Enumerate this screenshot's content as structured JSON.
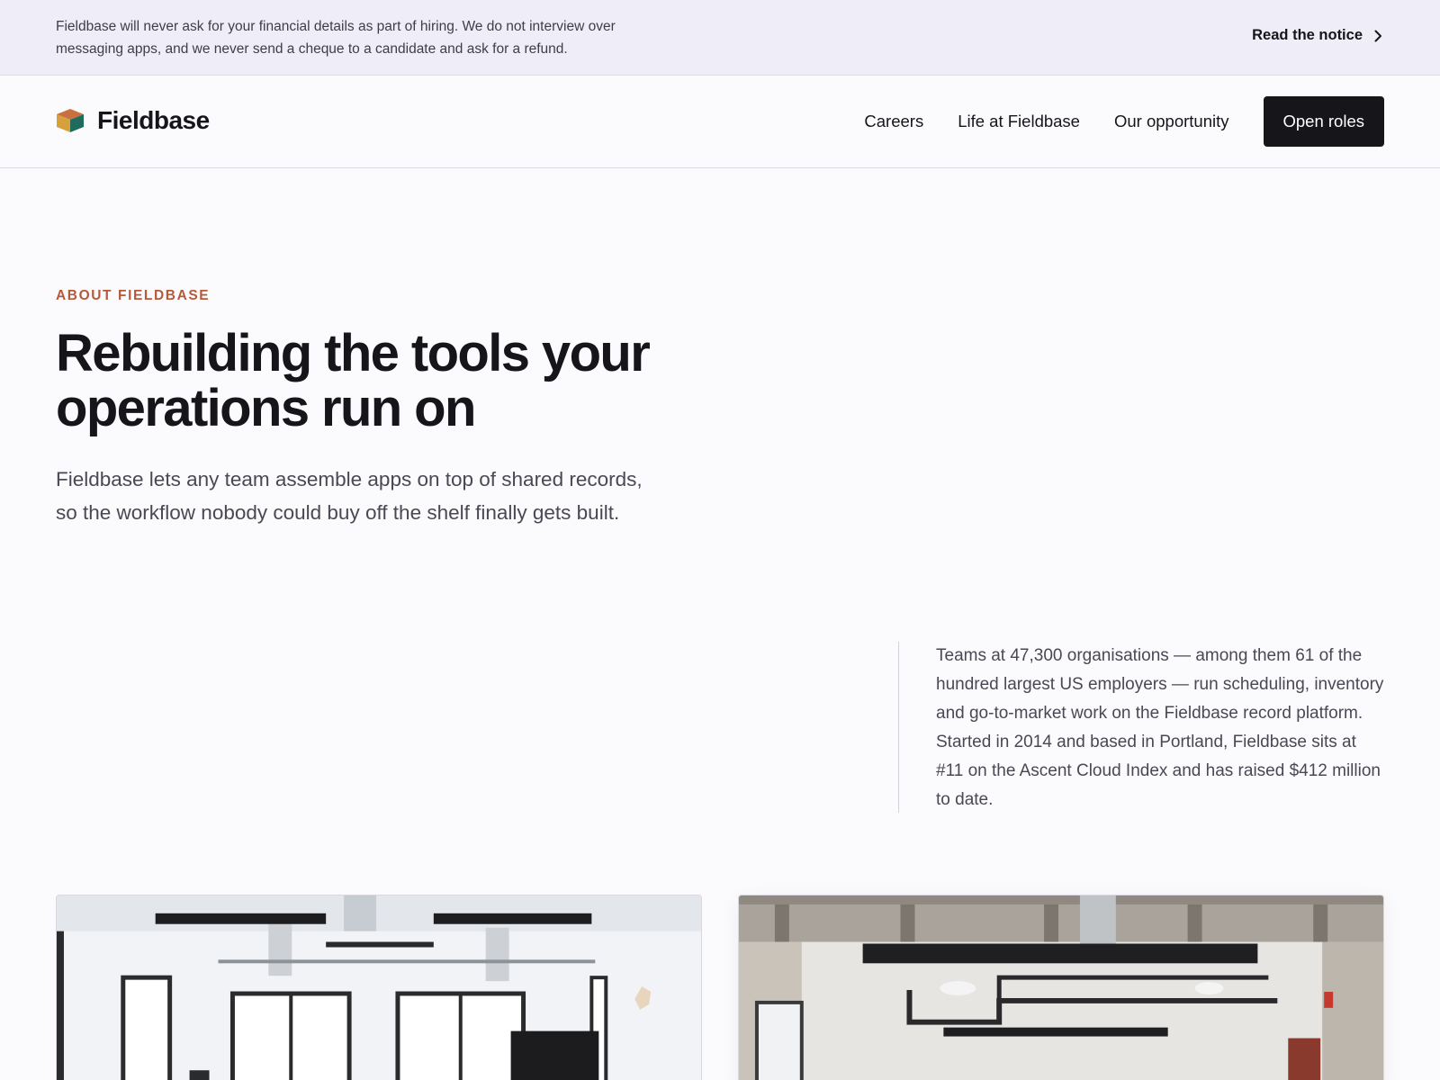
{
  "notice": {
    "text": "Fieldbase will never ask for your financial details as part of hiring. We do not interview over messaging apps, and we never send a cheque to a candidate and ask for a refund.",
    "link_label": "Read the notice",
    "link_icon": "chevron-right-icon"
  },
  "header": {
    "brand_name": "Fieldbase",
    "logo_icon": "cube-logo",
    "nav": [
      "Careers",
      "Life at Fieldbase",
      "Our opportunity"
    ],
    "cta_label": "Open roles"
  },
  "hero": {
    "eyebrow": "ABOUT FIELDBASE",
    "headline": "Rebuilding the tools your operations run on",
    "lede": "Fieldbase lets any team assemble apps on top of shared records, so the workflow nobody could buy off the shelf finally gets built."
  },
  "stats": {
    "text": "Teams at 47,300 organisations — among them 61 of the hundred largest US employers — run scheduling, inventory and go-to-market work on the Fieldbase record platform. Started in 2014 and based in Portland, Fieldbase sits at #11 on the Ascent Cloud Index and has raised $412 million to date."
  },
  "colors": {
    "accent": "#b55a3a",
    "ink": "#16151a",
    "banner_bg": "#efedf7",
    "page_bg": "#fbfafd",
    "logo_top": "#c8703f",
    "logo_left": "#d8a03a",
    "logo_right": "#1f6b5e"
  }
}
